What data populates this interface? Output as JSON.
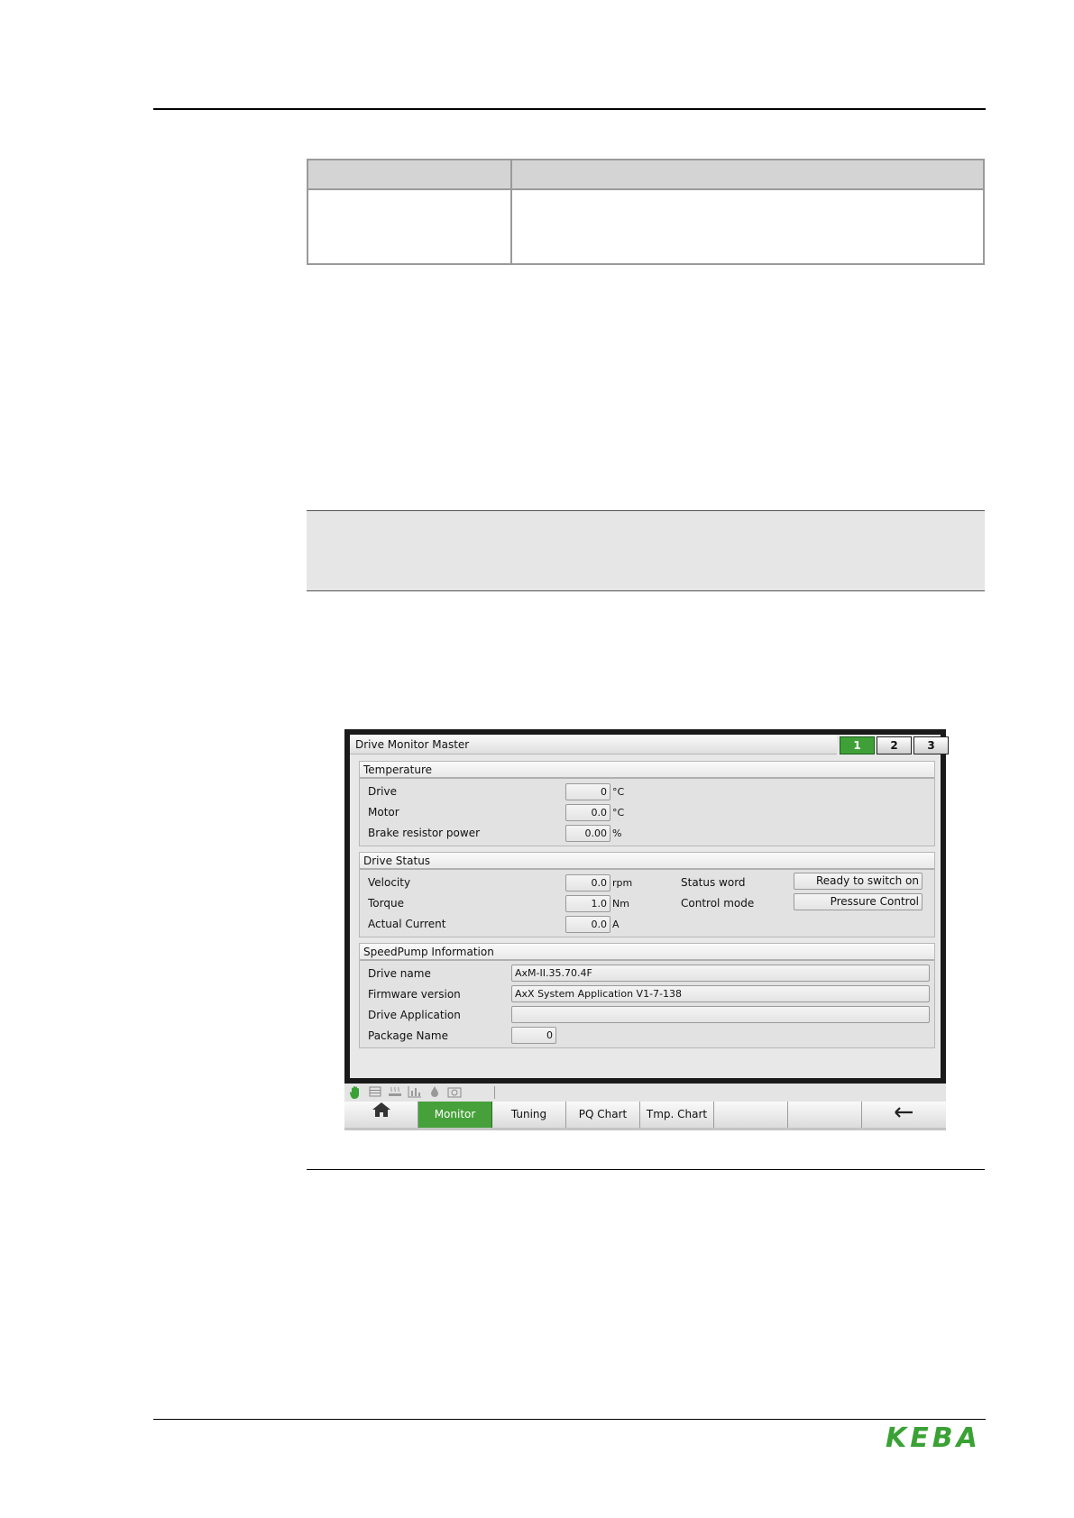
{
  "hmi": {
    "title": "Drive Monitor Master",
    "pages": [
      "1",
      "2",
      "3"
    ],
    "active_page": "1",
    "temperature": {
      "title": "Temperature",
      "rows": [
        {
          "label": "Drive",
          "value": "0",
          "unit": "°C"
        },
        {
          "label": "Motor",
          "value": "0.0",
          "unit": "°C"
        },
        {
          "label": "Brake resistor power",
          "value": "0.00",
          "unit": "%"
        }
      ]
    },
    "drive_status": {
      "title": "Drive Status",
      "rows": [
        {
          "label": "Velocity",
          "value": "0.0",
          "unit": "rpm"
        },
        {
          "label": "Torque",
          "value": "1.0",
          "unit": "Nm"
        },
        {
          "label": "Actual Current",
          "value": "0.0",
          "unit": "A"
        }
      ],
      "status_word_label": "Status word",
      "status_word_value": "Ready to switch on",
      "control_mode_label": "Control mode",
      "control_mode_value": "Pressure Control"
    },
    "speedpump": {
      "title": "SpeedPump Information",
      "drive_name_label": "Drive name",
      "drive_name_value": "AxM-II.35.70.4F",
      "firmware_label": "Firmware version",
      "firmware_value": "AxX System Application V1-7-138",
      "application_label": "Drive Application",
      "application_value": "",
      "package_label": "Package Name",
      "package_value": "0"
    },
    "status_icons": [
      "hand-icon",
      "list-icon",
      "heater-icon",
      "chart-icon",
      "drop-icon",
      "camera-icon"
    ],
    "nav": {
      "items": [
        "Monitor",
        "Tuning",
        "PQ Chart",
        "Tmp. Chart",
        "",
        ""
      ],
      "active": "Monitor",
      "home_icon": "home-icon",
      "back_icon": "back-arrow-icon"
    },
    "colors": {
      "active_green": "#46a13a",
      "brand_green": "#3aa135"
    }
  },
  "footer": {
    "logo_text": "KEBA"
  }
}
